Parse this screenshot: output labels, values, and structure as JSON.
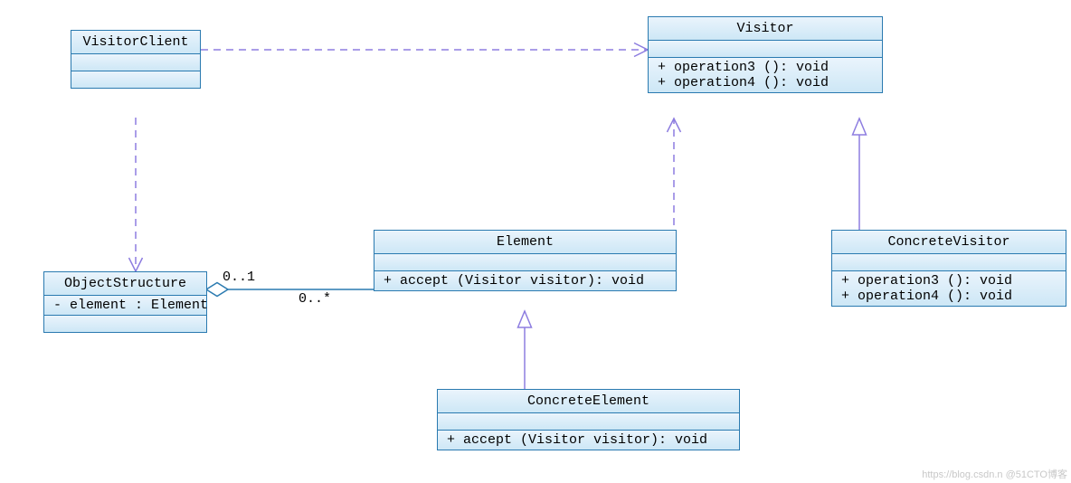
{
  "classes": {
    "visitorClient": {
      "name": "VisitorClient"
    },
    "objectStructure": {
      "name": "ObjectStructure",
      "attr": "- element : Element"
    },
    "element": {
      "name": "Element",
      "op": "+ accept (Visitor visitor): void"
    },
    "concreteElement": {
      "name": "ConcreteElement",
      "op": "+ accept (Visitor visitor): void"
    },
    "visitor": {
      "name": "Visitor",
      "op1": "+ operation3 (): void",
      "op2": "+ operation4 (): void"
    },
    "concreteVisitor": {
      "name": "ConcreteVisitor",
      "op1": "+ operation3 (): void",
      "op2": "+ operation4 (): void"
    }
  },
  "mult": {
    "agg_left": "0..1",
    "agg_right": "0..*"
  },
  "watermark": "https://blog.csdn.n @51CTO博客",
  "colors": {
    "stroke": "#2a7ab0",
    "dash": "#8d7de0",
    "fill": "#d9edf7"
  }
}
